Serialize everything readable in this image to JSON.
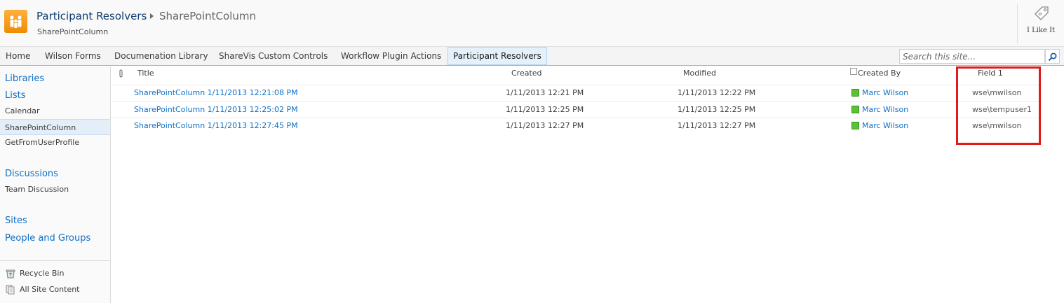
{
  "title_area": {
    "site_title": "Participant Resolvers",
    "current_page": "SharePointColumn",
    "subtitle": "SharePointColumn",
    "like_label": "I Like It"
  },
  "top_nav": {
    "items": [
      {
        "label": "Home"
      },
      {
        "label": "Wilson Forms"
      },
      {
        "label": "Documenation Library"
      },
      {
        "label": "ShareVis Custom Controls"
      },
      {
        "label": "Workflow Plugin Actions"
      },
      {
        "label": "Participant Resolvers",
        "selected": true
      }
    ],
    "search_placeholder": "Search this site..."
  },
  "left_nav": {
    "libraries": "Libraries",
    "lists": "Lists",
    "list_items": [
      "Calendar",
      "SharePointColumn",
      "GetFromUserProfile"
    ],
    "selected_item": "SharePointColumn",
    "discussions": "Discussions",
    "discussion_items": [
      "Team Discussion"
    ],
    "sites": "Sites",
    "people_and_groups": "People and Groups",
    "recycle_bin": "Recycle Bin",
    "all_site_content": "All Site Content"
  },
  "list": {
    "columns": {
      "title": "Title",
      "created": "Created",
      "modified": "Modified",
      "created_by": "Created By",
      "field1": "Field 1"
    },
    "rows": [
      {
        "title": "SharePointColumn 1/11/2013 12:21:08 PM",
        "created": "1/11/2013 12:21 PM",
        "modified": "1/11/2013 12:22 PM",
        "created_by": "Marc Wilson",
        "field1": "wse\\mwilson"
      },
      {
        "title": "SharePointColumn 1/11/2013 12:25:02 PM",
        "created": "1/11/2013 12:25 PM",
        "modified": "1/11/2013 12:25 PM",
        "created_by": "Marc Wilson",
        "field1": "wse\\tempuser1"
      },
      {
        "title": "SharePointColumn 1/11/2013 12:27:45 PM",
        "created": "1/11/2013 12:27 PM",
        "modified": "1/11/2013 12:27 PM",
        "created_by": "Marc Wilson",
        "field1": "wse\\mwilson"
      }
    ]
  },
  "colors": {
    "link": "#0f6fc6",
    "highlight": "#e01b1b",
    "presence": "#5bc236"
  }
}
